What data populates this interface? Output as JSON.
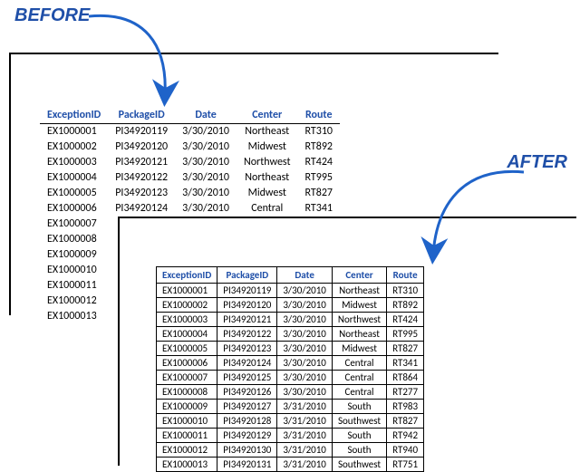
{
  "labels": {
    "before": "BEFORE",
    "after": "AFTER"
  },
  "columns": {
    "id": "ExceptionID",
    "pkg": "PackageID",
    "date": "Date",
    "center": "Center",
    "route": "Route"
  },
  "before_rows": [
    {
      "id": "EX1000001",
      "pkg": "PI34920119",
      "date": "3/30/2010",
      "center": "Northeast",
      "route": "RT310"
    },
    {
      "id": "EX1000002",
      "pkg": "PI34920120",
      "date": "3/30/2010",
      "center": "Midwest",
      "route": "RT892"
    },
    {
      "id": "EX1000003",
      "pkg": "PI34920121",
      "date": "3/30/2010",
      "center": "Northwest",
      "route": "RT424"
    },
    {
      "id": "EX1000004",
      "pkg": "PI34920122",
      "date": "3/30/2010",
      "center": "Northeast",
      "route": "RT995"
    },
    {
      "id": "EX1000005",
      "pkg": "PI34920123",
      "date": "3/30/2010",
      "center": "Midwest",
      "route": "RT827"
    },
    {
      "id": "EX1000006",
      "pkg": "PI34920124",
      "date": "3/30/2010",
      "center": "Central",
      "route": "RT341"
    },
    {
      "id": "EX1000007"
    },
    {
      "id": "EX1000008"
    },
    {
      "id": "EX1000009"
    },
    {
      "id": "EX1000010"
    },
    {
      "id": "EX1000011"
    },
    {
      "id": "EX1000012"
    },
    {
      "id": "EX1000013"
    }
  ],
  "after_rows": [
    {
      "id": "EX1000001",
      "pkg": "PI34920119",
      "date": "3/30/2010",
      "center": "Northeast",
      "route": "RT310"
    },
    {
      "id": "EX1000002",
      "pkg": "PI34920120",
      "date": "3/30/2010",
      "center": "Midwest",
      "route": "RT892"
    },
    {
      "id": "EX1000003",
      "pkg": "PI34920121",
      "date": "3/30/2010",
      "center": "Northwest",
      "route": "RT424"
    },
    {
      "id": "EX1000004",
      "pkg": "PI34920122",
      "date": "3/30/2010",
      "center": "Northeast",
      "route": "RT995"
    },
    {
      "id": "EX1000005",
      "pkg": "PI34920123",
      "date": "3/30/2010",
      "center": "Midwest",
      "route": "RT827"
    },
    {
      "id": "EX1000006",
      "pkg": "PI34920124",
      "date": "3/30/2010",
      "center": "Central",
      "route": "RT341"
    },
    {
      "id": "EX1000007",
      "pkg": "PI34920125",
      "date": "3/30/2010",
      "center": "Central",
      "route": "RT864"
    },
    {
      "id": "EX1000008",
      "pkg": "PI34920126",
      "date": "3/30/2010",
      "center": "Central",
      "route": "RT277"
    },
    {
      "id": "EX1000009",
      "pkg": "PI34920127",
      "date": "3/31/2010",
      "center": "South",
      "route": "RT983"
    },
    {
      "id": "EX1000010",
      "pkg": "PI34920128",
      "date": "3/31/2010",
      "center": "Southwest",
      "route": "RT827"
    },
    {
      "id": "EX1000011",
      "pkg": "PI34920129",
      "date": "3/31/2010",
      "center": "South",
      "route": "RT942"
    },
    {
      "id": "EX1000012",
      "pkg": "PI34920130",
      "date": "3/31/2010",
      "center": "South",
      "route": "RT940"
    },
    {
      "id": "EX1000013",
      "pkg": "PI34920131",
      "date": "3/31/2010",
      "center": "Southwest",
      "route": "RT751"
    }
  ]
}
